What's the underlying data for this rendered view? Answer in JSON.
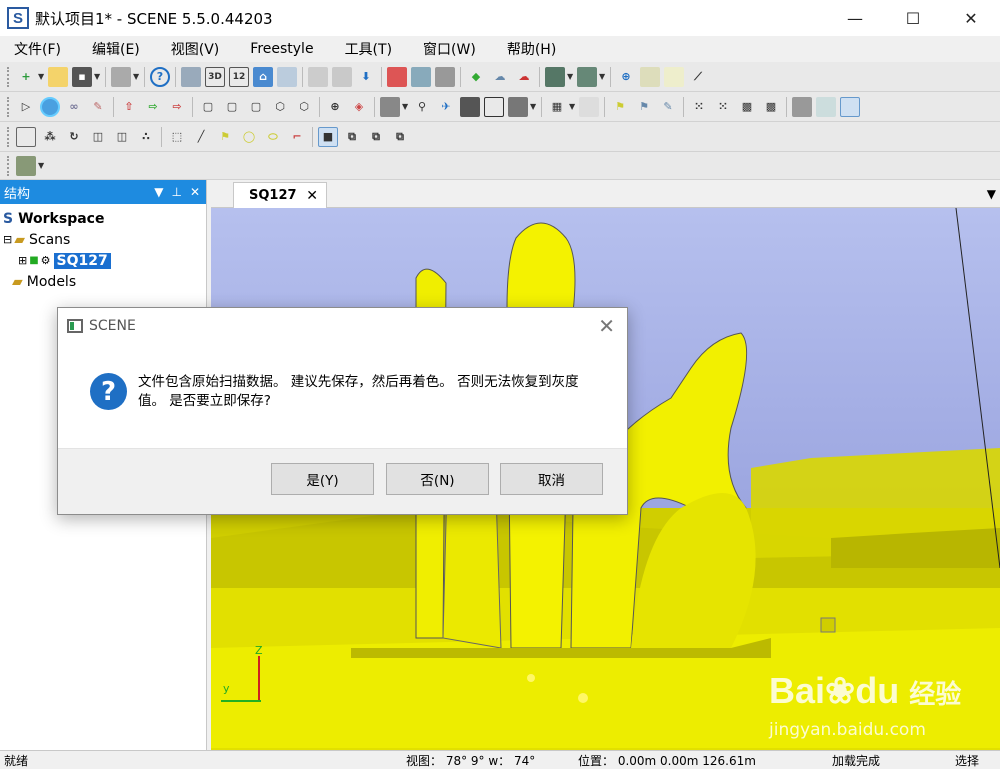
{
  "window": {
    "title": "默认项目1* - SCENE 5.5.0.44203",
    "app_icon_letter": "S"
  },
  "menu": [
    "文件(F)",
    "编辑(E)",
    "视图(V)",
    "Freestyle",
    "工具(T)",
    "窗口(W)",
    "帮助(H)"
  ],
  "toolbar": {
    "btn_3d": "3D",
    "btn_12": "12"
  },
  "panel": {
    "title": "结构",
    "tree": {
      "root": "Workspace",
      "scans": "Scans",
      "scan": "SQ127",
      "models": "Models"
    }
  },
  "tab": {
    "label": "SQ127"
  },
  "status": {
    "left": "就绪",
    "view": "视图： 78° 9° w： 74°",
    "position": "位置： 0.00m 0.00m 126.61m",
    "load": "加载完成",
    "extra": "选择"
  },
  "dialog": {
    "title": "SCENE",
    "icon": "?",
    "message": "文件包含原始扫描数据。 建议先保存，然后再着色。 否则无法恢复到灰度值。 是否要立即保存?",
    "buttons": {
      "yes": "是(Y)",
      "no": "否(N)",
      "cancel": "取消"
    }
  },
  "axes": {
    "z": "Z",
    "y": "y"
  },
  "watermark": {
    "brand": "Bai",
    "brand2": "du",
    "brand_cn": "经验",
    "url": "jingyan.baidu.com"
  },
  "colors": {
    "accent": "#1e8be0",
    "pointcloud": "#f2f000",
    "sky": "#a8b0e8"
  }
}
